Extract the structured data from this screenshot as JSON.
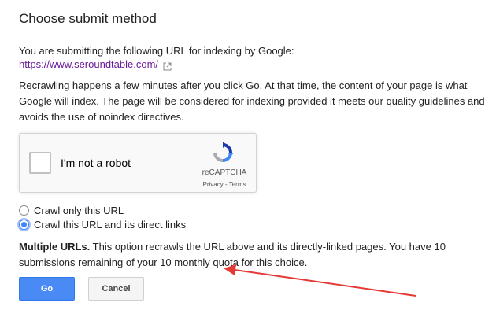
{
  "dialog": {
    "title": "Choose submit method",
    "intro": "You are submitting the following URL for indexing by Google:",
    "url": "https://www.seroundtable.com/",
    "description": "Recrawling happens a few minutes after you click Go. At that time, the content of your page is what Google will index. The page will be considered for indexing provided it meets our quality guidelines and avoids the use of noindex directives."
  },
  "captcha": {
    "label": "I'm not a robot",
    "brand": "reCAPTCHA",
    "terms": "Privacy - Terms",
    "icon": "recaptcha-icon"
  },
  "options": [
    {
      "label": "Crawl only this URL",
      "selected": false
    },
    {
      "label": "Crawl this URL and its direct links",
      "selected": true
    }
  ],
  "note": {
    "bold": "Multiple URLs.",
    "text": " This option recrawls the URL above and its directly-linked pages. You have 10 submissions remaining of your 10 monthly quota for this choice."
  },
  "buttons": {
    "go": "Go",
    "cancel": "Cancel"
  },
  "colors": {
    "link": "#6a1b9a",
    "primary": "#4a8af4",
    "annotation_arrow": "#e53935"
  }
}
